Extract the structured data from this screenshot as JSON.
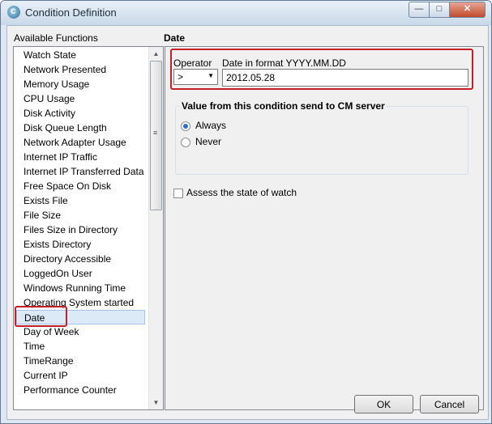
{
  "window": {
    "title": "Condition Definition",
    "min_glyph": "—",
    "max_glyph": "□",
    "close_glyph": "✕"
  },
  "functions": {
    "header": "Available Functions",
    "items": [
      "Watch State",
      "Network Presented",
      "Memory Usage",
      "CPU Usage",
      "Disk Activity",
      "Disk Queue Length",
      "Network Adapter Usage",
      "Internet IP Traffic",
      "Internet IP Transferred Data",
      "Free Space On Disk",
      "Exists File",
      "File Size",
      "Files Size in Directory",
      "Exists Directory",
      "Directory Accessible",
      "LoggedOn User",
      "Windows Running Time",
      "Operating System started",
      "Date",
      "Day of Week",
      "Time",
      "TimeRange",
      "Current IP",
      "Performance Counter"
    ],
    "selected": "Date"
  },
  "detail": {
    "header": "Date",
    "operator_label": "Operator",
    "operator_value": ">",
    "format_label": "Date in format YYYY.MM.DD",
    "date_value": "2012.05.28",
    "send_group": {
      "title": "Value from this condition send to CM server",
      "options": [
        "Always",
        "Never"
      ],
      "selected": "Always"
    },
    "assess_label": "Assess the state of watch",
    "assess_checked": false
  },
  "buttons": {
    "ok": "OK",
    "cancel": "Cancel"
  },
  "colors": {
    "highlight": "#c21f27",
    "selection": "#dce9f7",
    "radio": "#2a6fc9"
  }
}
